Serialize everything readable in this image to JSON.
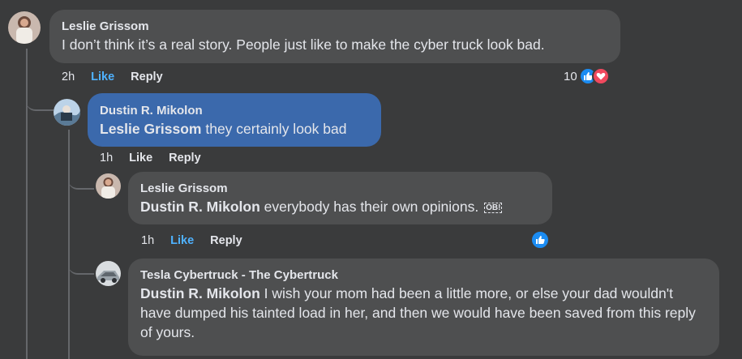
{
  "comments": [
    {
      "author": "Leslie Grissom",
      "mention": "",
      "text": "I don’t think it’s a real story. People just like to make the cyber truck look bad.",
      "time": "2h",
      "like": "Like",
      "reply": "Reply",
      "reaction_count": "10",
      "reactions": [
        "like-icon",
        "heart-icon"
      ]
    },
    {
      "author": "Dustin R. Mikolon",
      "mention": "Leslie Grissom",
      "text": " they certainly look bad",
      "time": "1h",
      "like": "Like",
      "reply": "Reply"
    },
    {
      "author": "Leslie Grissom",
      "mention": "Dustin R. Mikolon",
      "text": " everybody has their own opinions.",
      "emoji": "OB!",
      "time": "1h",
      "like": "Like",
      "reply": "Reply",
      "reactions": [
        "like-icon"
      ]
    },
    {
      "author": "Tesla Cybertruck - The Cybertruck",
      "mention": "Dustin R. Mikolon",
      "text": " I wish your mom had been a little more, or else your dad wouldn't have dumped his tainted load in her, and then we would have been saved from this reply of yours."
    }
  ],
  "colors": {
    "background": "#3a3b3c",
    "bubble": "#4e4f50",
    "highlighted_bubble": "#3b69ac",
    "like_active": "#4fb2ff"
  }
}
